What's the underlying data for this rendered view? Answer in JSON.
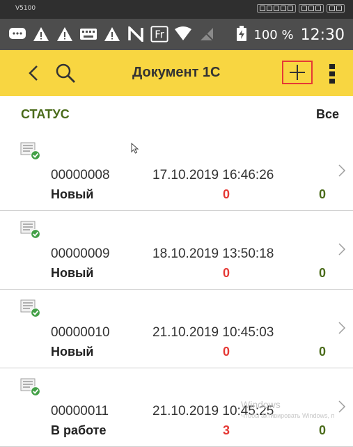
{
  "device": {
    "model": "V5100"
  },
  "status_bar": {
    "icons": [
      "message-icon",
      "warning-icon",
      "warning-icon",
      "keyboard-icon",
      "warning-icon",
      "nfc-icon",
      "fr-icon",
      "wifi-icon",
      "no-sim-icon"
    ],
    "fr_label": "Fr",
    "battery": "100 %",
    "time": "12:30"
  },
  "app_bar": {
    "title": "Документ 1С",
    "back_icon": "chevron-left-icon",
    "search_icon": "search-icon",
    "add_icon": "plus-icon",
    "more_icon": "more-vertical-icon"
  },
  "filter": {
    "label": "СТАТУС",
    "value": "Все"
  },
  "documents": [
    {
      "number": "00000008",
      "date": "17.10.2019 16:46:26",
      "status": "Новый",
      "count_red": "0",
      "count_green": "0"
    },
    {
      "number": "00000009",
      "date": "18.10.2019 13:50:18",
      "status": "Новый",
      "count_red": "0",
      "count_green": "0"
    },
    {
      "number": "00000010",
      "date": "21.10.2019 10:45:03",
      "status": "Новый",
      "count_red": "0",
      "count_green": "0"
    },
    {
      "number": "00000011",
      "date": "21.10.2019 10:45:25",
      "status": "В работе",
      "count_red": "3",
      "count_green": "0"
    }
  ],
  "watermark": {
    "title": "Windows",
    "subtitle": "Чтобы активировать Windows, п"
  },
  "colors": {
    "app_bar": "#f8d641",
    "accent_green": "#4a6b1a",
    "accent_red": "#e53935"
  }
}
